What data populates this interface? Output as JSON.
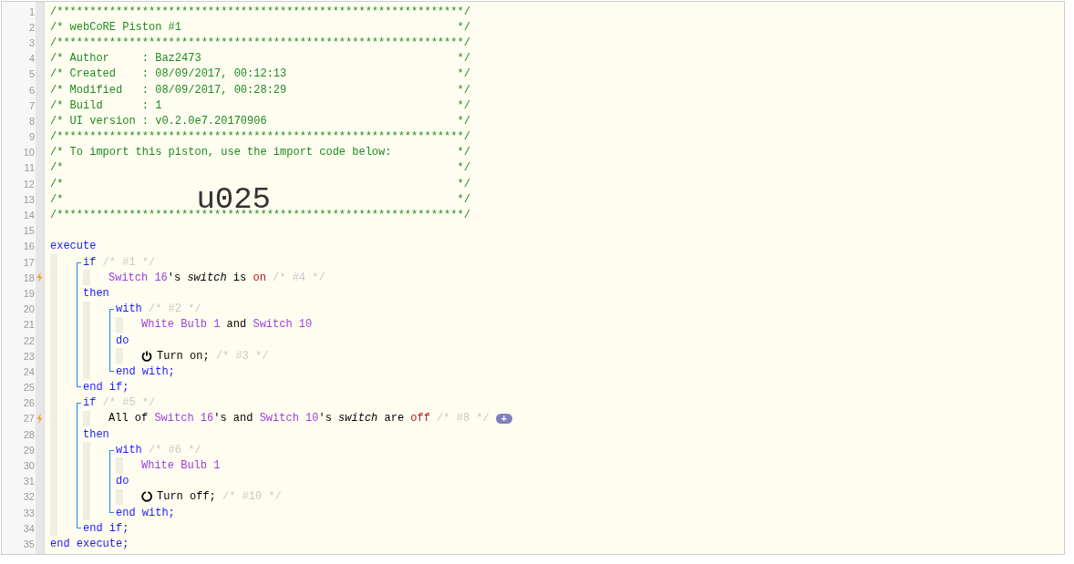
{
  "line_numbers": [
    {
      "number": "1",
      "trigger": false
    },
    {
      "number": "2",
      "trigger": false
    },
    {
      "number": "3",
      "trigger": false
    },
    {
      "number": "4",
      "trigger": false
    },
    {
      "number": "5",
      "trigger": false
    },
    {
      "number": "6",
      "trigger": false
    },
    {
      "number": "7",
      "trigger": false
    },
    {
      "number": "8",
      "trigger": false
    },
    {
      "number": "9",
      "trigger": false
    },
    {
      "number": "10",
      "trigger": false
    },
    {
      "number": "11",
      "trigger": false
    },
    {
      "number": "12",
      "trigger": false
    },
    {
      "number": "13",
      "trigger": false
    },
    {
      "number": "14",
      "trigger": false
    },
    {
      "number": "15",
      "trigger": false
    },
    {
      "number": "16",
      "trigger": false
    },
    {
      "number": "17",
      "trigger": false
    },
    {
      "number": "18",
      "trigger": true
    },
    {
      "number": "19",
      "trigger": false
    },
    {
      "number": "20",
      "trigger": false
    },
    {
      "number": "21",
      "trigger": false
    },
    {
      "number": "22",
      "trigger": false
    },
    {
      "number": "23",
      "trigger": false
    },
    {
      "number": "24",
      "trigger": false
    },
    {
      "number": "25",
      "trigger": false
    },
    {
      "number": "26",
      "trigger": false
    },
    {
      "number": "27",
      "trigger": true
    },
    {
      "number": "28",
      "trigger": false
    },
    {
      "number": "29",
      "trigger": false
    },
    {
      "number": "30",
      "trigger": false
    },
    {
      "number": "31",
      "trigger": false
    },
    {
      "number": "32",
      "trigger": false
    },
    {
      "number": "33",
      "trigger": false
    },
    {
      "number": "34",
      "trigger": false
    },
    {
      "number": "35",
      "trigger": false
    }
  ],
  "header": [
    {
      "text": "/**************************************************************/"
    },
    {
      "text": "/* webCoRE Piston #1",
      "end": "*/"
    },
    {
      "text": "/**************************************************************/"
    },
    {
      "text": "/* Author     : Baz2473",
      "end": "*/"
    },
    {
      "text": "/* Created    : 08/09/2017, 00:12:13",
      "end": "*/"
    },
    {
      "text": "/* Modified   : 08/09/2017, 00:28:29",
      "end": "*/"
    },
    {
      "text": "/* Build      : 1",
      "end": "*/"
    },
    {
      "text": "/* UI version : v0.2.0e7.20170906",
      "end": "*/"
    },
    {
      "text": "/**************************************************************/"
    },
    {
      "text": "/* To import this piston, use the import code below:",
      "end": "*/"
    },
    {
      "text": "/*",
      "end": "*/"
    },
    {
      "text": "/*",
      "end": "*/"
    },
    {
      "text": "/*",
      "code": "u025",
      "end": "*/"
    },
    {
      "text": "/**************************************************************/"
    }
  ],
  "program": {
    "open": [
      {
        "kind": "keyword",
        "text": "execute"
      }
    ],
    "children": [
      {
        "kind": "if",
        "open": [
          {
            "kind": "keyword",
            "text": "if"
          },
          {
            "kind": "comment",
            "text": " /* #1 */"
          }
        ],
        "condition": [
          {
            "kind": "device",
            "text": "Switch 16"
          },
          {
            "kind": "text",
            "text": "'s "
          },
          {
            "kind": "attribute",
            "text": "switch"
          },
          {
            "kind": "text",
            "text": " is "
          },
          {
            "kind": "value",
            "text": "on"
          },
          {
            "kind": "comment",
            "text": " /* #4 */"
          }
        ],
        "then": [
          {
            "kind": "keyword",
            "text": "then"
          }
        ],
        "children": [
          {
            "kind": "with",
            "open": [
              {
                "kind": "keyword",
                "text": "with"
              },
              {
                "kind": "comment",
                "text": " /* #2 */"
              }
            ],
            "devices": [
              {
                "kind": "device",
                "text": "White Bulb 1"
              },
              {
                "kind": "text",
                "text": " and "
              },
              {
                "kind": "device",
                "text": "Switch 10"
              }
            ],
            "do": [
              {
                "kind": "keyword",
                "text": "do"
              }
            ],
            "children": [
              {
                "kind": "turnon",
                "text": [
                  {
                    "kind": "text",
                    "text": "Turn on;"
                  },
                  {
                    "kind": "comment",
                    "text": " /* #3 */"
                  }
                ]
              }
            ],
            "close": [
              {
                "kind": "keyword",
                "text": "end with;"
              }
            ]
          }
        ],
        "close": [
          {
            "kind": "keyword",
            "text": "end if;"
          }
        ]
      },
      {
        "kind": "if",
        "open": [
          {
            "kind": "keyword",
            "text": "if"
          },
          {
            "kind": "comment",
            "text": " /* #5 */"
          }
        ],
        "condition": [
          {
            "kind": "text",
            "text": "All of "
          },
          {
            "kind": "device",
            "text": "Switch 16"
          },
          {
            "kind": "text",
            "text": "'s and "
          },
          {
            "kind": "device",
            "text": "Switch 10"
          },
          {
            "kind": "text",
            "text": "'s "
          },
          {
            "kind": "attribute",
            "text": "switch"
          },
          {
            "kind": "text",
            "text": " are "
          },
          {
            "kind": "value",
            "text": "off"
          },
          {
            "kind": "comment",
            "text": " /* #8 */"
          }
        ],
        "add_button": "+",
        "then": [
          {
            "kind": "keyword",
            "text": "then"
          }
        ],
        "children": [
          {
            "kind": "with",
            "open": [
              {
                "kind": "keyword",
                "text": "with"
              },
              {
                "kind": "comment",
                "text": " /* #6 */"
              }
            ],
            "devices": [
              {
                "kind": "device",
                "text": "White Bulb 1"
              }
            ],
            "do": [
              {
                "kind": "keyword",
                "text": "do"
              }
            ],
            "children": [
              {
                "kind": "turnoff",
                "text": [
                  {
                    "kind": "text",
                    "text": "Turn off;"
                  },
                  {
                    "kind": "comment",
                    "text": " /* #10 */"
                  }
                ]
              }
            ],
            "close": [
              {
                "kind": "keyword",
                "text": "end with;"
              }
            ]
          }
        ],
        "close": [
          {
            "kind": "keyword",
            "text": "end if;"
          }
        ]
      }
    ],
    "close": [
      {
        "kind": "keyword",
        "text": "end execute;"
      }
    ]
  }
}
